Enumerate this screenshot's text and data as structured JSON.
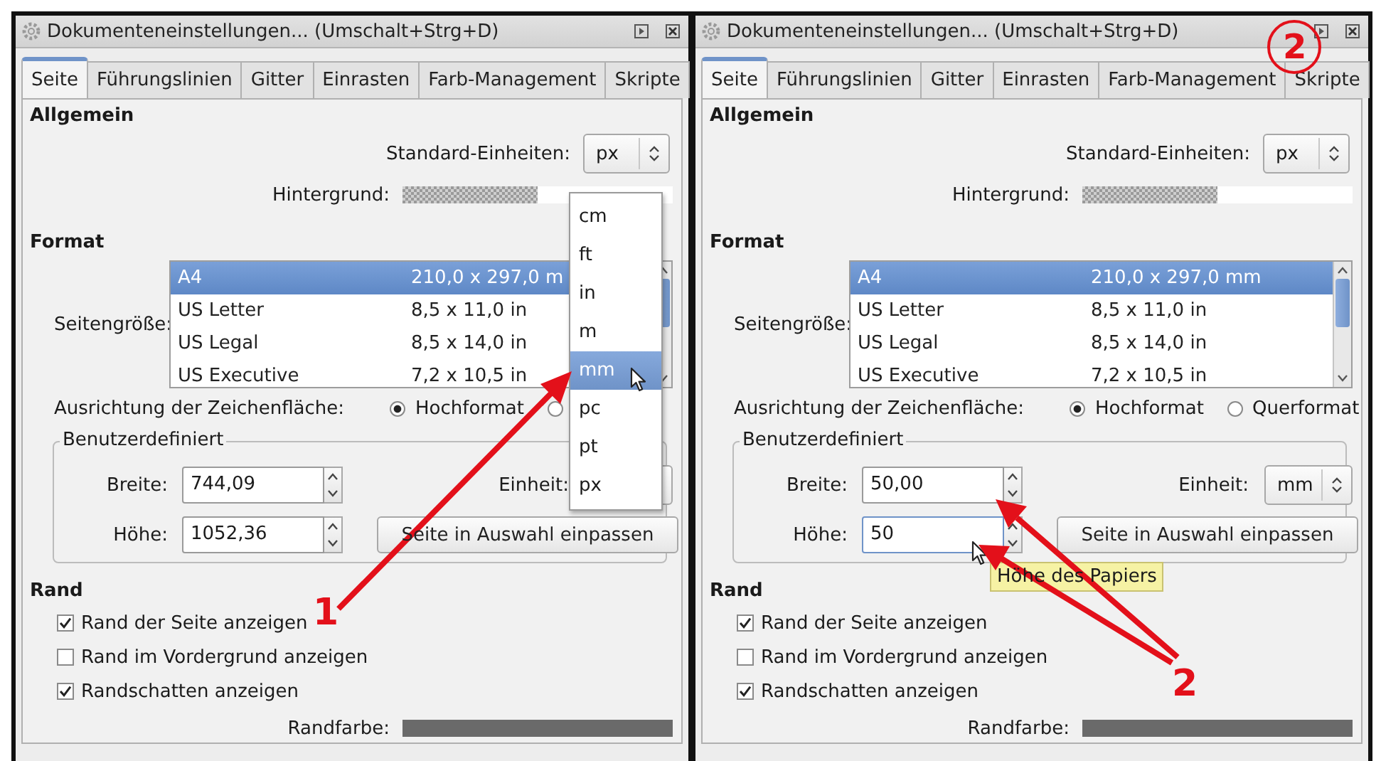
{
  "panels": [
    {
      "title": "Dokumenteneinstellungen... (Umschalt+Strg+D)",
      "tabs": [
        {
          "label": "Seite",
          "selected": true
        },
        {
          "label": "Führungslinien",
          "selected": false
        },
        {
          "label": "Gitter",
          "selected": false
        },
        {
          "label": "Einrasten",
          "selected": false
        },
        {
          "label": "Farb-Management",
          "selected": false
        },
        {
          "label": "Skripte",
          "selected": false
        }
      ],
      "general": {
        "heading": "Allgemein",
        "units_label": "Standard-Einheiten:",
        "units_value": "px",
        "background_label": "Hintergrund:"
      },
      "format": {
        "heading": "Format",
        "size_label": "Seitengröße:",
        "sizes": [
          {
            "name": "A4",
            "dims": "210,0 x 297,0 m",
            "selected": true
          },
          {
            "name": "US Letter",
            "dims": "8,5 x 11,0 in",
            "selected": false
          },
          {
            "name": "US Legal",
            "dims": "8,5 x 14,0 in",
            "selected": false
          },
          {
            "name": "US Executive",
            "dims": "7,2 x 10,5 in",
            "selected": false
          }
        ],
        "orientation_label": "Ausrichtung der Zeichenfläche:",
        "orientations": [
          {
            "label": "Hochformat",
            "selected": true
          },
          {
            "selected": false
          }
        ],
        "custom": {
          "legend": "Benutzerdefiniert",
          "width_label": "Breite:",
          "width_value": "744,09",
          "height_label": "Höhe:",
          "height_value": "1052,36",
          "height_focused": false,
          "unit_label": "Einheit:",
          "fit_button": "Seite in Auswahl einpassen"
        }
      },
      "border": {
        "heading": "Rand",
        "options": [
          {
            "label": "Rand der Seite anzeigen",
            "checked": true
          },
          {
            "label": "Rand im Vordergrund anzeigen",
            "checked": false
          },
          {
            "label": "Randschatten anzeigen",
            "checked": true
          }
        ],
        "color_label": "Randfarbe:"
      },
      "unit_menu": [
        {
          "label": "cm",
          "selected": false
        },
        {
          "label": "ft",
          "selected": false
        },
        {
          "label": "in",
          "selected": false
        },
        {
          "label": "m",
          "selected": false
        },
        {
          "label": "mm",
          "selected": true
        },
        {
          "label": "pc",
          "selected": false
        },
        {
          "label": "pt",
          "selected": false
        },
        {
          "label": "px",
          "selected": false
        }
      ]
    },
    {
      "title": "Dokumenteneinstellungen... (Umschalt+Strg+D)",
      "tabs": [
        {
          "label": "Seite",
          "selected": true
        },
        {
          "label": "Führungslinien",
          "selected": false
        },
        {
          "label": "Gitter",
          "selected": false
        },
        {
          "label": "Einrasten",
          "selected": false
        },
        {
          "label": "Farb-Management",
          "selected": false
        },
        {
          "label": "Skripte",
          "selected": false
        }
      ],
      "general": {
        "heading": "Allgemein",
        "units_label": "Standard-Einheiten:",
        "units_value": "px",
        "background_label": "Hintergrund:"
      },
      "format": {
        "heading": "Format",
        "size_label": "Seitengröße:",
        "sizes": [
          {
            "name": "A4",
            "dims": "210,0 x 297,0 mm",
            "selected": true
          },
          {
            "name": "US Letter",
            "dims": "8,5 x 11,0 in",
            "selected": false
          },
          {
            "name": "US Legal",
            "dims": "8,5 x 14,0 in",
            "selected": false
          },
          {
            "name": "US Executive",
            "dims": "7,2 x 10,5 in",
            "selected": false
          }
        ],
        "orientation_label": "Ausrichtung der Zeichenfläche:",
        "orientations": [
          {
            "label": "Hochformat",
            "selected": true
          },
          {
            "label": "Querformat",
            "selected": false
          }
        ],
        "custom": {
          "legend": "Benutzerdefiniert",
          "width_label": "Breite:",
          "width_value": "50,00",
          "height_label": "Höhe:",
          "height_value": "50",
          "height_focused": true,
          "unit_label": "Einheit:",
          "unit_value": "mm",
          "fit_button": "Seite in Auswahl einpassen"
        }
      },
      "border": {
        "heading": "Rand",
        "options": [
          {
            "label": "Rand der Seite anzeigen",
            "checked": true
          },
          {
            "label": "Rand im Vordergrund anzeigen",
            "checked": false
          },
          {
            "label": "Randschatten anzeigen",
            "checked": true
          }
        ],
        "color_label": "Randfarbe:"
      },
      "tooltip": "Höhe des Papiers"
    }
  ],
  "annotations": {
    "labels": [
      "1",
      "2"
    ],
    "badge": "2"
  }
}
